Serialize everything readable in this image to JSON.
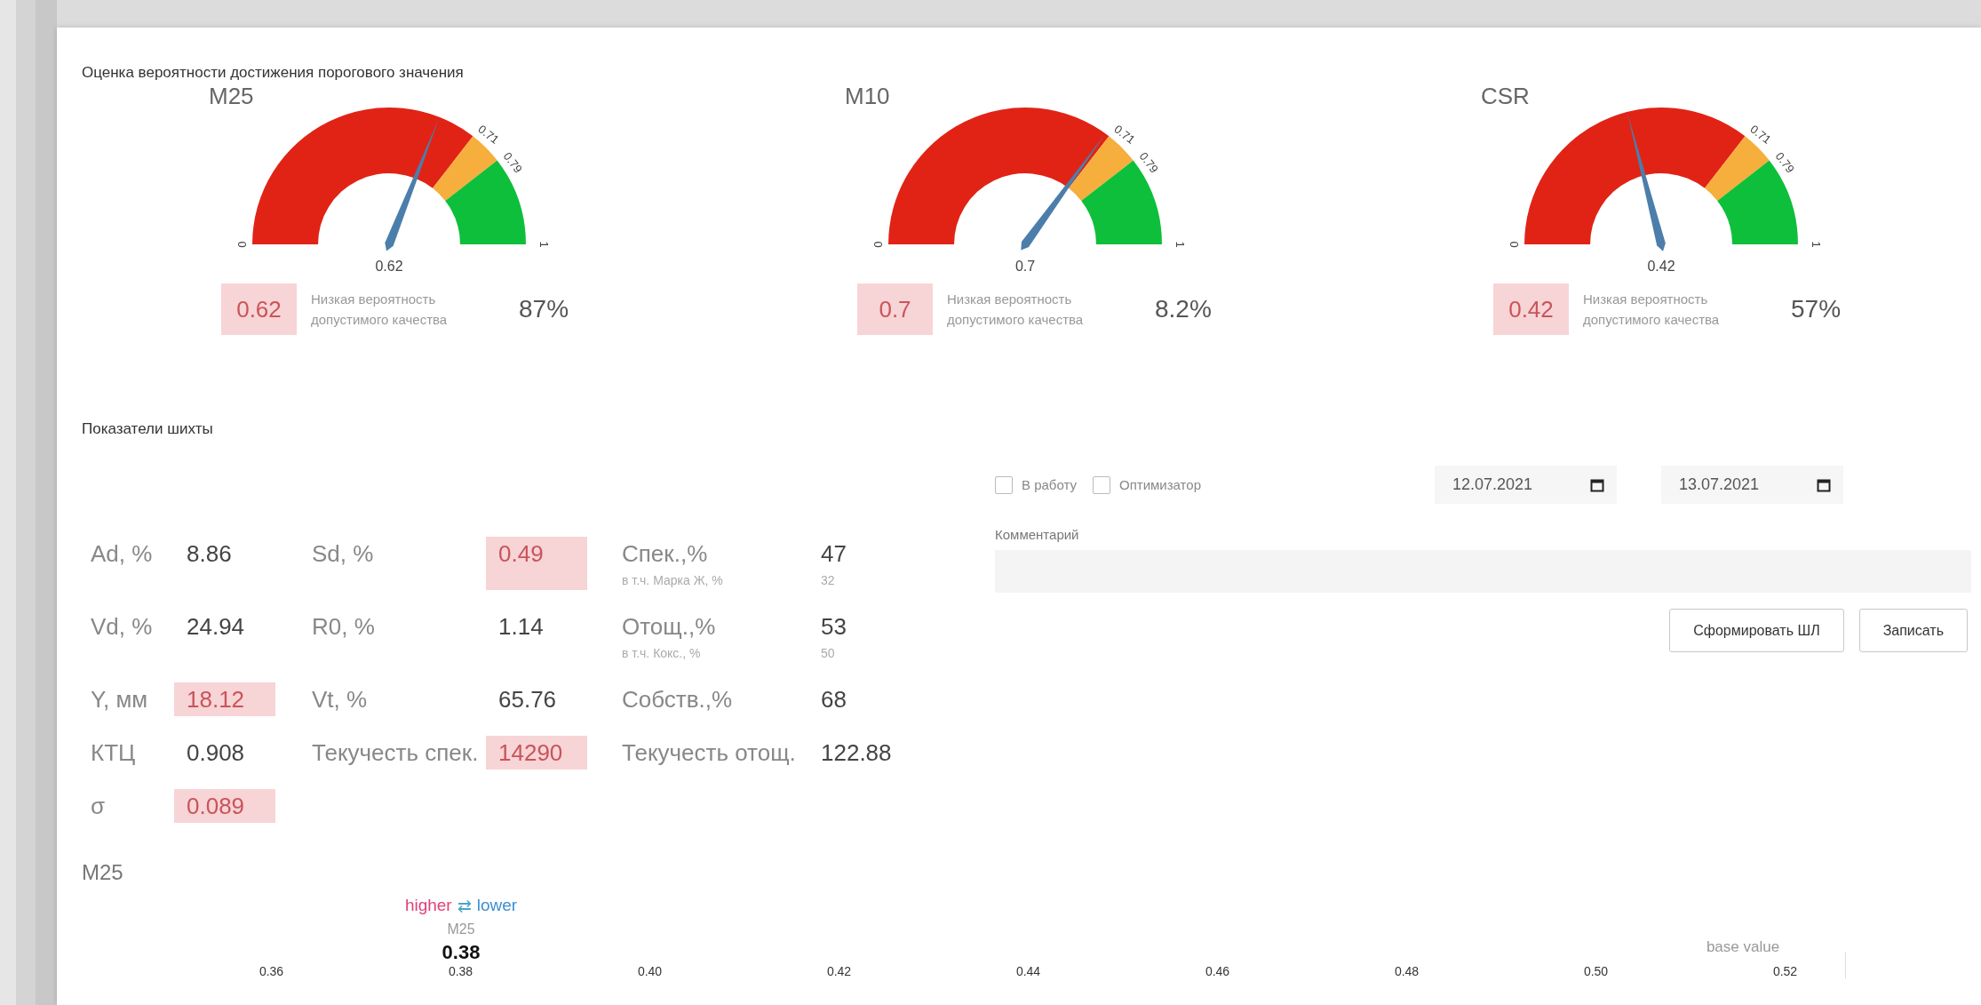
{
  "gauge_section": {
    "title": "Оценка вероятности достижения порогового значения",
    "gauges": [
      {
        "title": "M25",
        "min_label": "0",
        "max_label": "1",
        "thresholds": [
          "0.71",
          "0.79"
        ],
        "value_label": "0.62",
        "score": "0.62",
        "score_flagged": true,
        "description": "Низкая вероятность допустимого качества",
        "percent": "87%"
      },
      {
        "title": "M10",
        "min_label": "0",
        "max_label": "1",
        "thresholds": [
          "0.71",
          "0.79"
        ],
        "value_label": "0.7",
        "score": "0.7",
        "score_flagged": true,
        "description": "Низкая вероятность допустимого качества",
        "percent": "8.2%"
      },
      {
        "title": "CSR",
        "min_label": "0",
        "max_label": "1",
        "thresholds": [
          "0.71",
          "0.79"
        ],
        "value_label": "0.42",
        "score": "0.42",
        "score_flagged": true,
        "description": "Низкая вероятность допустимого качества",
        "percent": "57%"
      }
    ]
  },
  "charge_section": {
    "title": "Показатели шихты",
    "rows": [
      [
        {
          "label": "Ad, %",
          "value": "8.86",
          "flagged": false
        },
        {
          "label": "Sd, %",
          "value": "0.49",
          "flagged": true
        },
        {
          "label": "Спек.,%",
          "value": "47",
          "flagged": false,
          "sub_label": "в т.ч. Марка Ж, %",
          "sub_value": "32"
        }
      ],
      [
        {
          "label": "Vd, %",
          "value": "24.94",
          "flagged": false
        },
        {
          "label": "R0, %",
          "value": "1.14",
          "flagged": false
        },
        {
          "label": "Отощ.,%",
          "value": "53",
          "flagged": false,
          "sub_label": "в т.ч. Кокс., %",
          "sub_value": "50"
        }
      ],
      [
        {
          "label": "Y, мм",
          "value": "18.12",
          "flagged": true
        },
        {
          "label": "Vt, %",
          "value": "65.76",
          "flagged": false
        },
        {
          "label": "Собств.,%",
          "value": "68",
          "flagged": false
        }
      ],
      [
        {
          "label": "КТЦ",
          "value": "0.908",
          "flagged": false
        },
        {
          "label": "Текучесть спек.",
          "value": "14290",
          "flagged": true
        },
        {
          "label": "Текучесть отощ.",
          "value": "122.88",
          "flagged": false
        }
      ],
      [
        {
          "label": "σ",
          "value": "0.089",
          "flagged": true
        }
      ]
    ]
  },
  "controls": {
    "checkboxes": [
      {
        "label": "В работу",
        "checked": false
      },
      {
        "label": "Оптимизатор",
        "checked": false
      }
    ],
    "date_from": "12.07.2021",
    "date_to": "13.07.2021",
    "comment_label": "Комментарий",
    "buttons": [
      "Сформировать ШЛ",
      "Записать"
    ]
  },
  "force_plot": {
    "title": "M25",
    "higher": "higher",
    "arrow": "⇄",
    "lower": "lower",
    "output_name": "M25",
    "output_value": "0.38",
    "base_label": "base value",
    "ticks": [
      "0.36",
      "0.38",
      "0.40",
      "0.42",
      "0.44",
      "0.46",
      "0.48",
      "0.50",
      "0.52"
    ]
  }
}
